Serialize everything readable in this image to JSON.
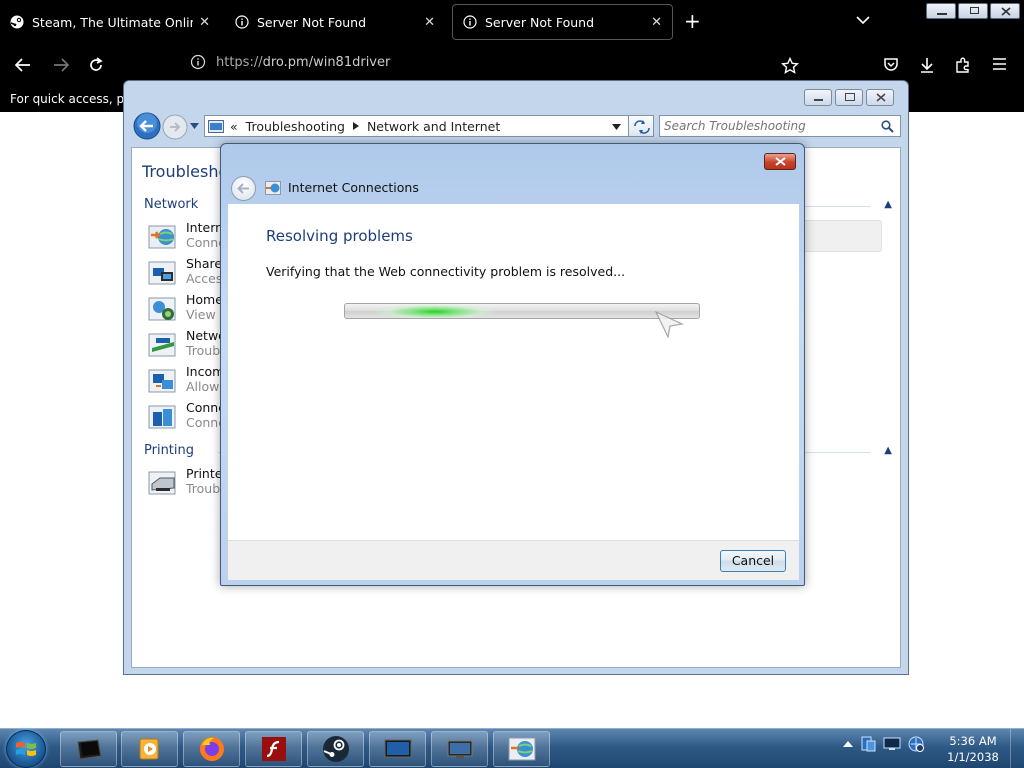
{
  "browser": {
    "tabs": [
      {
        "title": "Steam, The Ultimate Online Ga",
        "icon": "steam-icon",
        "active": false
      },
      {
        "title": "Server Not Found",
        "icon": "info-icon",
        "active": false
      },
      {
        "title": "Server Not Found",
        "icon": "info-icon",
        "active": true
      }
    ],
    "url_scheme": "https://",
    "url_rest": "dro.pm/win81driver",
    "bookmark_hint": "For quick access, plac"
  },
  "explorer": {
    "breadcrumb_prefix": "«",
    "breadcrumb": [
      "Troubleshooting",
      "Network and Internet"
    ],
    "search_placeholder": "Search Troubleshooting",
    "heading": "Troubleshoo",
    "groups": {
      "network": "Network",
      "printing": "Printing"
    },
    "items": [
      {
        "title": "Interne",
        "subtitle": "Conne",
        "icon": "internet-connections-icon"
      },
      {
        "title": "Shared",
        "subtitle": "Access",
        "icon": "shared-folders-icon"
      },
      {
        "title": "Home",
        "subtitle": "View c",
        "icon": "homegroup-icon"
      },
      {
        "title": "Netwo",
        "subtitle": "Troubl",
        "icon": "network-adapter-icon"
      },
      {
        "title": "Incom",
        "subtitle": "Allow",
        "icon": "incoming-connections-icon"
      },
      {
        "title": "Conne",
        "subtitle": "Conne",
        "icon": "connection-workplace-icon"
      }
    ],
    "printing_items": [
      {
        "title": "Printer",
        "subtitle": "Troubl",
        "icon": "printer-icon"
      }
    ]
  },
  "dialog": {
    "title": "Internet Connections",
    "heading": "Resolving problems",
    "message": "Verifying that the Web connectivity problem is resolved...",
    "progress_indeterminate": true,
    "cancel_label": "Cancel"
  },
  "taskbar": {
    "apps": [
      "terminal-icon",
      "media-player-icon",
      "firefox-icon",
      "flash-icon",
      "steam-icon",
      "monitor-icon",
      "display-icon",
      "network-troubleshooter-icon"
    ],
    "time": "5:36 AM",
    "date": "1/1/2038"
  },
  "colors": {
    "heading_blue": "#1e3d7b",
    "progress_green": "#22d422",
    "taskbar_blue": "#2f5a86"
  }
}
